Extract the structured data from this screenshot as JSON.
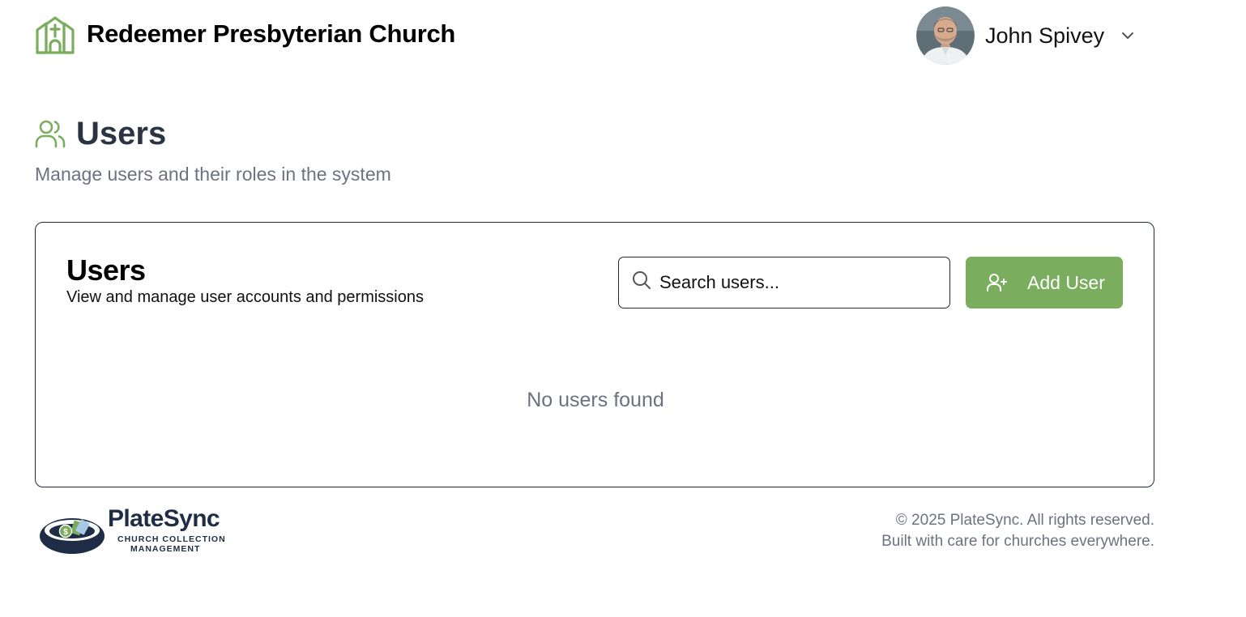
{
  "header": {
    "church_name": "Redeemer Presbyterian Church",
    "user_name": "John Spivey"
  },
  "page": {
    "title": "Users",
    "subtitle": "Manage users and their roles in the system"
  },
  "card": {
    "title": "Users",
    "subtitle": "View and manage user accounts and permissions",
    "search_placeholder": "Search users...",
    "add_button_label": "Add User",
    "empty_message": "No users found"
  },
  "footer": {
    "logo_name": "PlateSync",
    "logo_sub_line1": "CHURCH COLLECTION",
    "logo_sub_line2": "MANAGEMENT",
    "copyright": "© 2025 PlateSync. All rights reserved.",
    "tagline": "Built with care for churches everywhere."
  },
  "colors": {
    "brand_green": "#7bad5e",
    "title_dark": "#2b3442",
    "muted_text": "#6b7280",
    "logo_navy": "#1e2d45"
  },
  "icons": {
    "church": "church-icon",
    "users": "users-icon",
    "search": "search-icon",
    "add_user": "user-plus-icon",
    "dropdown": "chevron-down-icon"
  }
}
